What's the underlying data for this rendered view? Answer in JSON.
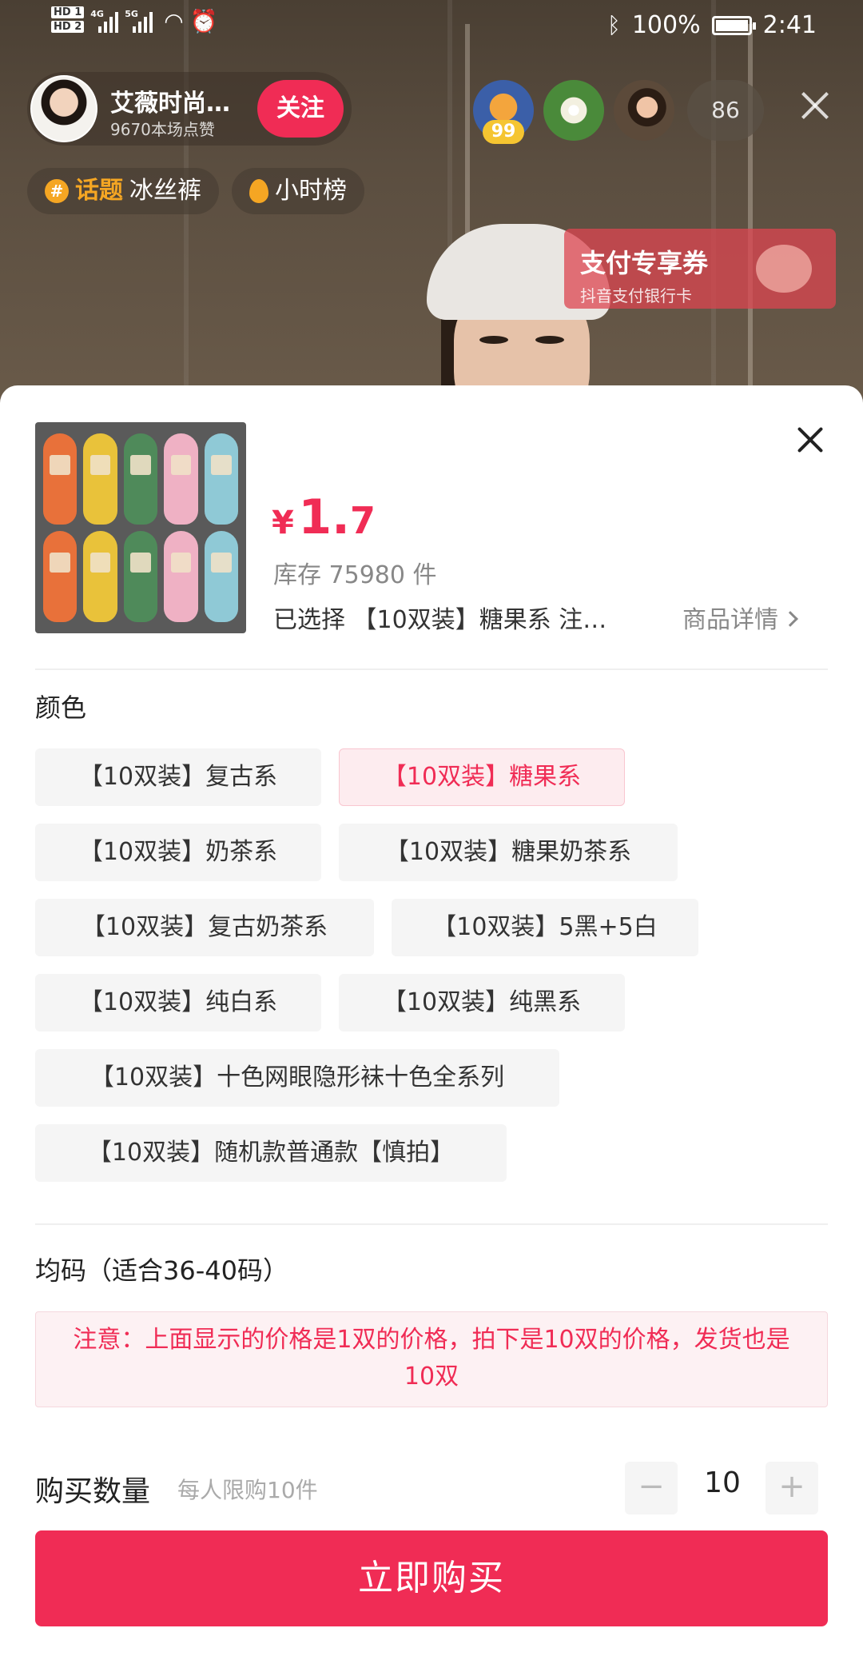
{
  "status_bar": {
    "net_gen1": "4G",
    "net_gen2": "5G",
    "battery": "100%",
    "time": "2:41"
  },
  "live": {
    "host_name": "艾薇时尚…",
    "host_likes": "9670本场点赞",
    "follow_label": "关注",
    "viewer_badge": "99",
    "viewer_count": "86",
    "tag_topic_label": "话题",
    "tag_topic_value": "冰丝裤",
    "tag_rank": "小时榜",
    "coupon_title": "支付专享券",
    "coupon_subtitle": "抖音支付银行卡"
  },
  "product": {
    "currency": "¥",
    "price_int": "1.",
    "price_dec": "7",
    "stock": "库存 75980 件",
    "selected": "已选择 【10双装】糖果系 注…",
    "detail_link": "商品详情",
    "sock_colors": [
      "#e8713a",
      "#e9c23a",
      "#4f8a5a",
      "#efb1c4",
      "#8fc9d6"
    ]
  },
  "color_section": {
    "label": "颜色",
    "options": [
      "【10双装】复古系",
      "【10双装】糖果系",
      "【10双装】奶茶系",
      "【10双装】糖果奶茶系",
      "【10双装】复古奶茶系",
      "【10双装】5黑+5白",
      "【10双装】纯白系",
      "【10双装】纯黑系",
      "【10双装】十色网眼隐形袜十色全系列",
      "【10双装】随机款普通款【慎拍】"
    ],
    "selected_index": 1
  },
  "size_section": {
    "label": "均码（适合36-40码）"
  },
  "notice": "注意：上面显示的价格是1双的价格，拍下是10双的价格，发货也是10双",
  "quantity": {
    "label": "购买数量",
    "limit": "每人限购10件",
    "value": "10",
    "minus": "−",
    "plus": "+"
  },
  "buy_label": "立即购买",
  "colors": {
    "accent": "#f02c55"
  }
}
